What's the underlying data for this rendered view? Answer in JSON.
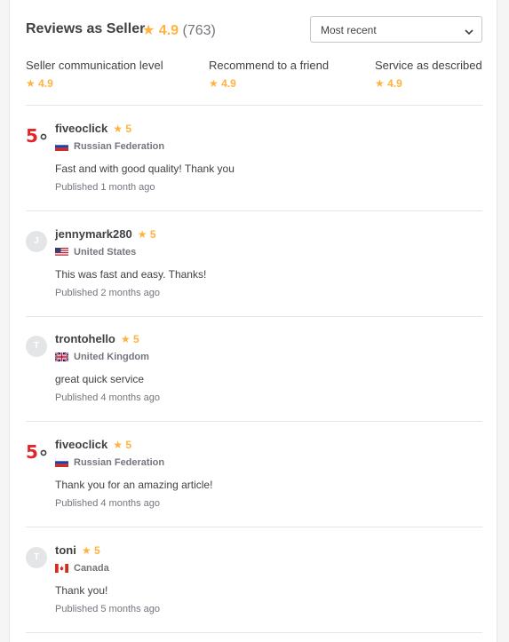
{
  "header": {
    "title": "Reviews as Seller",
    "rating": "4.9",
    "count": "(763)",
    "sort_value": "Most recent"
  },
  "breakdown": [
    {
      "label": "Seller communication level",
      "value": "4.9"
    },
    {
      "label": "Recommend to a friend",
      "value": "4.9"
    },
    {
      "label": "Service as described",
      "value": "4.9"
    }
  ],
  "reviews": [
    {
      "avatar": "logo",
      "user": "fiveoclick",
      "rating": "5",
      "country": "Russian Federation",
      "flag": "ru-flag-icon",
      "text": "Fast and with good quality! Thank you",
      "date": "Published 1 month ago"
    },
    {
      "avatar": "J",
      "user": "jennymark280",
      "rating": "5",
      "country": "United States",
      "flag": "us-flag-icon",
      "text": "This was fast and easy. Thanks!",
      "date": "Published 2 months ago"
    },
    {
      "avatar": "T",
      "user": "trontohello",
      "rating": "5",
      "country": "United Kingdom",
      "flag": "uk-flag-icon",
      "text": "great quick service",
      "date": "Published 4 months ago"
    },
    {
      "avatar": "logo",
      "user": "fiveoclick",
      "rating": "5",
      "country": "Russian Federation",
      "flag": "ru-flag-icon",
      "text": "Thank you for an amazing article!",
      "date": "Published 4 months ago"
    },
    {
      "avatar": "T",
      "user": "toni",
      "rating": "5",
      "country": "Canada",
      "flag": "ca-flag-icon",
      "text": "Thank you!",
      "date": "Published 5 months ago"
    }
  ],
  "colors": {
    "star": "#ffb33e",
    "text": "#404145",
    "muted": "#74767e",
    "divider": "#e4e5e7"
  }
}
